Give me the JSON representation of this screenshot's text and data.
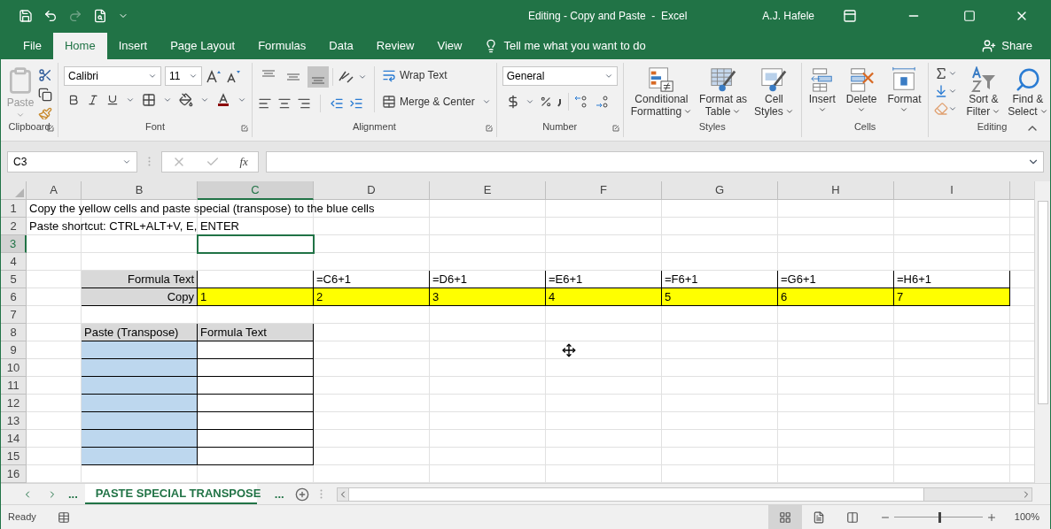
{
  "window": {
    "title": "Editing - Copy and Paste  -  Excel",
    "user": "A.J. Hafele"
  },
  "tabs": [
    {
      "label": "File",
      "selected": false
    },
    {
      "label": "Home",
      "selected": true
    },
    {
      "label": "Insert",
      "selected": false
    },
    {
      "label": "Page Layout",
      "selected": false
    },
    {
      "label": "Formulas",
      "selected": false
    },
    {
      "label": "Data",
      "selected": false
    },
    {
      "label": "Review",
      "selected": false
    },
    {
      "label": "View",
      "selected": false
    }
  ],
  "tell_me": "Tell me what you want to do",
  "share": "Share",
  "ribbon": [
    {
      "kind": "clipboard",
      "name": "Clipboard",
      "paste": "Paste",
      "disabled": true
    },
    {
      "kind": "font",
      "name": "Font",
      "font": "Calibri",
      "size": "11"
    },
    {
      "kind": "alignment",
      "name": "Alignment",
      "wrap": "Wrap Text",
      "merge": "Merge & Center",
      "vertical_align": [
        {
          "selected": false
        },
        {
          "selected": false
        },
        {
          "selected": true
        }
      ]
    },
    {
      "kind": "number",
      "name": "Number",
      "format": "General"
    },
    {
      "kind": "styles",
      "name": "Styles",
      "buttons": [
        {
          "lines": [
            "Conditional",
            "Formatting"
          ]
        },
        {
          "lines": [
            "Format as",
            "Table"
          ]
        },
        {
          "lines": [
            "Cell",
            "Styles"
          ]
        }
      ]
    },
    {
      "kind": "cells",
      "name": "Cells",
      "buttons": [
        {
          "lines": [
            "Insert"
          ]
        },
        {
          "lines": [
            "Delete"
          ]
        },
        {
          "lines": [
            "Format"
          ]
        }
      ]
    },
    {
      "kind": "editing",
      "name": "Editing",
      "buttons": [
        {
          "lines": [
            "Sort &",
            "Filter"
          ]
        },
        {
          "lines": [
            "Find &",
            "Select"
          ]
        }
      ]
    }
  ],
  "formula_bar": {
    "name_box": "C3",
    "fx": "fx"
  },
  "columns": [
    {
      "label": "A",
      "selected": false
    },
    {
      "label": "B",
      "selected": false
    },
    {
      "label": "C",
      "selected": true
    },
    {
      "label": "D",
      "selected": false
    },
    {
      "label": "E",
      "selected": false
    },
    {
      "label": "F",
      "selected": false
    },
    {
      "label": "G",
      "selected": false
    },
    {
      "label": "H",
      "selected": false
    },
    {
      "label": "I",
      "selected": false
    }
  ],
  "rows": [
    {
      "number": "1",
      "selected": false,
      "cells": [
        {
          "text": "Copy the yellow cells and paste special (transpose) to the blue cells",
          "bordered": false,
          "selected": false
        },
        {
          "bordered": false,
          "selected": false
        },
        {
          "bordered": false,
          "selected": false
        },
        {
          "bordered": false,
          "selected": false
        },
        {
          "bordered": false,
          "selected": false
        },
        {
          "bordered": false,
          "selected": false
        },
        {
          "bordered": false,
          "selected": false
        },
        {
          "bordered": false,
          "selected": false
        },
        {
          "bordered": false,
          "selected": false
        }
      ]
    },
    {
      "number": "2",
      "selected": false,
      "cells": [
        {
          "text": "Paste shortcut: CTRL+ALT+V, E, ENTER",
          "bordered": false,
          "selected": false
        },
        {
          "bordered": false,
          "selected": false
        },
        {
          "bordered": false,
          "selected": false
        },
        {
          "bordered": false,
          "selected": false
        },
        {
          "bordered": false,
          "selected": false
        },
        {
          "bordered": false,
          "selected": false
        },
        {
          "bordered": false,
          "selected": false
        },
        {
          "bordered": false,
          "selected": false
        },
        {
          "bordered": false,
          "selected": false
        }
      ]
    },
    {
      "number": "3",
      "selected": true,
      "cells": [
        {
          "bordered": false,
          "selected": false
        },
        {
          "bordered": false,
          "selected": false
        },
        {
          "bordered": false,
          "selected": true
        },
        {
          "bordered": false,
          "selected": false
        },
        {
          "bordered": false,
          "selected": false
        },
        {
          "bordered": false,
          "selected": false
        },
        {
          "bordered": false,
          "selected": false
        },
        {
          "bordered": false,
          "selected": false
        },
        {
          "bordered": false,
          "selected": false
        }
      ]
    },
    {
      "number": "4",
      "selected": false
    },
    {
      "number": "5",
      "selected": false,
      "cells": [
        {
          "bordered": false,
          "selected": false
        },
        {
          "text": "Formula Text",
          "color": "#d9d9d9",
          "kind": "row_label",
          "bordered": true,
          "selected": false
        },
        {
          "bordered": true,
          "selected": false
        },
        {
          "text": "=C6+1",
          "bordered": true,
          "selected": false
        },
        {
          "text": "=D6+1",
          "bordered": true,
          "selected": false
        },
        {
          "text": "=E6+1",
          "bordered": true,
          "selected": false
        },
        {
          "text": "=F6+1",
          "bordered": true,
          "selected": false
        },
        {
          "text": "=G6+1",
          "bordered": true,
          "selected": false
        },
        {
          "text": "=H6+1",
          "bordered": true,
          "selected": false
        }
      ]
    },
    {
      "number": "6",
      "selected": false,
      "cells": [
        {
          "bordered": false,
          "selected": false
        },
        {
          "text": "Copy",
          "color": "#d9d9d9",
          "kind": "row_label",
          "bordered": true,
          "selected": false
        },
        {
          "text": "1",
          "color": "#ffff00",
          "bordered": true,
          "selected": false
        },
        {
          "text": "2",
          "color": "#ffff00",
          "bordered": true,
          "selected": false
        },
        {
          "text": "3",
          "color": "#ffff00",
          "bordered": true,
          "selected": false
        },
        {
          "text": "4",
          "color": "#ffff00",
          "bordered": true,
          "selected": false
        },
        {
          "text": "5",
          "color": "#ffff00",
          "bordered": true,
          "selected": false
        },
        {
          "text": "6",
          "color": "#ffff00",
          "bordered": true,
          "selected": false
        },
        {
          "text": "7",
          "color": "#ffff00",
          "bordered": true,
          "selected": false
        }
      ]
    },
    {
      "number": "7",
      "selected": false
    },
    {
      "number": "8",
      "selected": false,
      "cells": [
        {
          "bordered": false,
          "selected": false
        },
        {
          "text": "Paste (Transpose)",
          "color": "#d9d9d9",
          "bordered": true,
          "selected": false
        },
        {
          "text": "Formula Text",
          "color": "#d9d9d9",
          "bordered": true,
          "selected": false
        },
        {
          "bordered": false,
          "selected": false
        },
        {
          "bordered": false,
          "selected": false
        },
        {
          "bordered": false,
          "selected": false
        },
        {
          "bordered": false,
          "selected": false
        },
        {
          "bordered": false,
          "selected": false
        },
        {
          "bordered": false,
          "selected": false
        }
      ]
    },
    {
      "number": "9",
      "selected": false,
      "cells": [
        {
          "bordered": false,
          "selected": false
        },
        {
          "color": "#bdd7ee",
          "bordered": true,
          "selected": false
        },
        {
          "bordered": true,
          "selected": false
        },
        {
          "bordered": false,
          "selected": false
        },
        {
          "bordered": false,
          "selected": false
        },
        {
          "bordered": false,
          "selected": false
        },
        {
          "bordered": false,
          "selected": false
        },
        {
          "bordered": false,
          "selected": false
        },
        {
          "bordered": false,
          "selected": false
        }
      ]
    },
    {
      "number": "10",
      "selected": false,
      "cells": [
        {
          "bordered": false,
          "selected": false
        },
        {
          "color": "#bdd7ee",
          "bordered": true,
          "selected": false
        },
        {
          "bordered": true,
          "selected": false
        },
        {
          "bordered": false,
          "selected": false
        },
        {
          "bordered": false,
          "selected": false
        },
        {
          "bordered": false,
          "selected": false
        },
        {
          "bordered": false,
          "selected": false
        },
        {
          "bordered": false,
          "selected": false
        },
        {
          "bordered": false,
          "selected": false
        }
      ]
    },
    {
      "number": "11",
      "selected": false,
      "cells": [
        {
          "bordered": false,
          "selected": false
        },
        {
          "color": "#bdd7ee",
          "bordered": true,
          "selected": false
        },
        {
          "bordered": true,
          "selected": false
        },
        {
          "bordered": false,
          "selected": false
        },
        {
          "bordered": false,
          "selected": false
        },
        {
          "bordered": false,
          "selected": false
        },
        {
          "bordered": false,
          "selected": false
        },
        {
          "bordered": false,
          "selected": false
        },
        {
          "bordered": false,
          "selected": false
        }
      ]
    },
    {
      "number": "12",
      "selected": false,
      "cells": [
        {
          "bordered": false,
          "selected": false
        },
        {
          "color": "#bdd7ee",
          "bordered": true,
          "selected": false
        },
        {
          "bordered": true,
          "selected": false
        },
        {
          "bordered": false,
          "selected": false
        },
        {
          "bordered": false,
          "selected": false
        },
        {
          "bordered": false,
          "selected": false
        },
        {
          "bordered": false,
          "selected": false
        },
        {
          "bordered": false,
          "selected": false
        },
        {
          "bordered": false,
          "selected": false
        }
      ]
    },
    {
      "number": "13",
      "selected": false,
      "cells": [
        {
          "bordered": false,
          "selected": false
        },
        {
          "color": "#bdd7ee",
          "bordered": true,
          "selected": false
        },
        {
          "bordered": true,
          "selected": false
        },
        {
          "bordered": false,
          "selected": false
        },
        {
          "bordered": false,
          "selected": false
        },
        {
          "bordered": false,
          "selected": false
        },
        {
          "bordered": false,
          "selected": false
        },
        {
          "bordered": false,
          "selected": false
        },
        {
          "bordered": false,
          "selected": false
        }
      ]
    },
    {
      "number": "14",
      "selected": false,
      "cells": [
        {
          "bordered": false,
          "selected": false
        },
        {
          "color": "#bdd7ee",
          "bordered": true,
          "selected": false
        },
        {
          "bordered": true,
          "selected": false
        },
        {
          "bordered": false,
          "selected": false
        },
        {
          "bordered": false,
          "selected": false
        },
        {
          "bordered": false,
          "selected": false
        },
        {
          "bordered": false,
          "selected": false
        },
        {
          "bordered": false,
          "selected": false
        },
        {
          "bordered": false,
          "selected": false
        }
      ]
    },
    {
      "number": "15",
      "selected": false,
      "cells": [
        {
          "bordered": false,
          "selected": false
        },
        {
          "color": "#bdd7ee",
          "bordered": true,
          "selected": false
        },
        {
          "bordered": true,
          "selected": false
        },
        {
          "bordered": false,
          "selected": false
        },
        {
          "bordered": false,
          "selected": false
        },
        {
          "bordered": false,
          "selected": false
        },
        {
          "bordered": false,
          "selected": false
        },
        {
          "bordered": false,
          "selected": false
        },
        {
          "bordered": false,
          "selected": false
        }
      ]
    },
    {
      "number": "16",
      "selected": false
    }
  ],
  "sheet_tabs": {
    "more_left": "...",
    "more_right": "...",
    "tabs": [
      {
        "label": "PASTE SPECIAL TRANSPOSE",
        "selected": true
      }
    ]
  },
  "status_bar": {
    "status": "Ready",
    "views": [
      {
        "selected": true
      },
      {
        "selected": false
      },
      {
        "selected": false
      }
    ],
    "zoom": {
      "level": 0.5,
      "reading": "100%"
    }
  }
}
